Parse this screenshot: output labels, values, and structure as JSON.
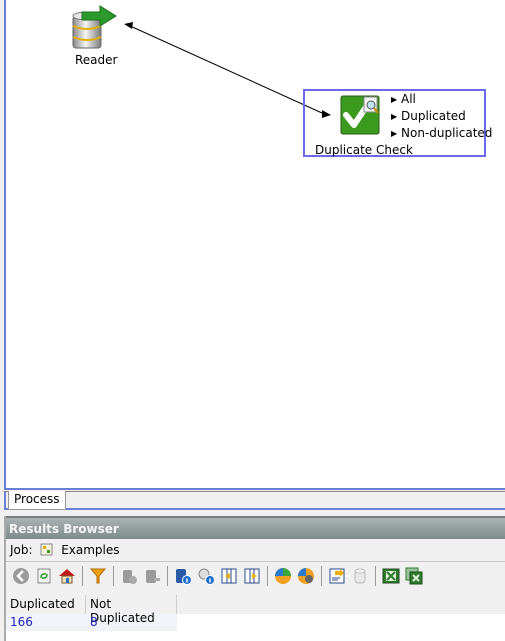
{
  "canvas": {
    "nodes": {
      "reader": {
        "label": "Reader",
        "icon": "database-reader-icon"
      },
      "duplicate_check": {
        "label": "Duplicate Check",
        "icon": "duplicate-check-icon",
        "ports": [
          "All",
          "Duplicated",
          "Non-duplicated"
        ]
      }
    },
    "connections": [
      {
        "from": "Reader",
        "to": "Duplicate Check"
      }
    ],
    "selection_color": "#6b6bea"
  },
  "tabs": {
    "process": "Process"
  },
  "results_browser": {
    "title": "Results Browser",
    "job_label": "Job:",
    "job_name": "Examples",
    "toolbar": [
      "back-icon",
      "refresh-icon",
      "home-icon",
      "|",
      "filter-icon",
      "|",
      "db-disabled-icon",
      "db-export-disabled-icon",
      "|",
      "db-info-icon",
      "settings-info-icon",
      "columns-left-icon",
      "columns-right-icon",
      "|",
      "pie-chart-icon",
      "chart-settings-icon",
      "|",
      "report-icon",
      "cylinder-disabled-icon",
      "|",
      "excel-icon",
      "excel-multi-icon"
    ],
    "table": {
      "columns": [
        "Duplicated",
        "Not Duplicated"
      ],
      "rows": [
        [
          "166",
          "8"
        ]
      ]
    }
  }
}
